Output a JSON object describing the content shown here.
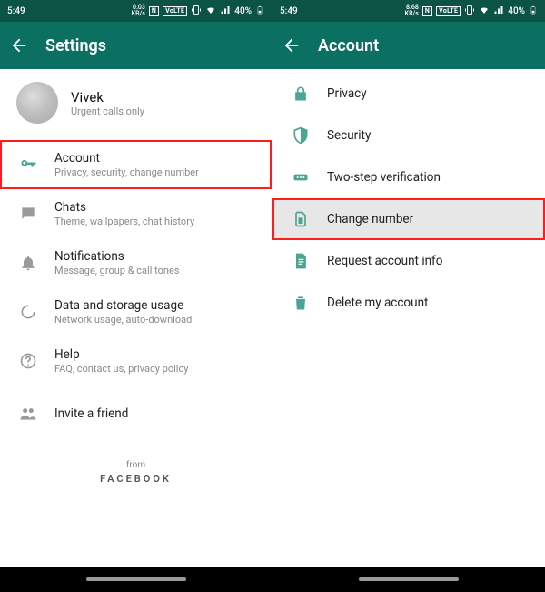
{
  "statusbar": {
    "time": "5:49",
    "net_left": "0.03",
    "net_right": "8.68",
    "net_unit": "KB/s",
    "nfc": "N",
    "volte": "VoLTE",
    "battery": "40%"
  },
  "left": {
    "title": "Settings",
    "profile": {
      "name": "Vivek",
      "sub": "Urgent calls only"
    },
    "items": [
      {
        "title": "Account",
        "sub": "Privacy, security, change number"
      },
      {
        "title": "Chats",
        "sub": "Theme, wallpapers, chat history"
      },
      {
        "title": "Notifications",
        "sub": "Message, group & call tones"
      },
      {
        "title": "Data and storage usage",
        "sub": "Network usage, auto-download"
      },
      {
        "title": "Help",
        "sub": "FAQ, contact us, privacy policy"
      },
      {
        "title": "Invite a friend",
        "sub": ""
      }
    ],
    "from": "from",
    "brand": "FACEBOOK"
  },
  "right": {
    "title": "Account",
    "items": [
      {
        "title": "Privacy"
      },
      {
        "title": "Security"
      },
      {
        "title": "Two-step verification"
      },
      {
        "title": "Change number"
      },
      {
        "title": "Request account info"
      },
      {
        "title": "Delete my account"
      }
    ]
  }
}
